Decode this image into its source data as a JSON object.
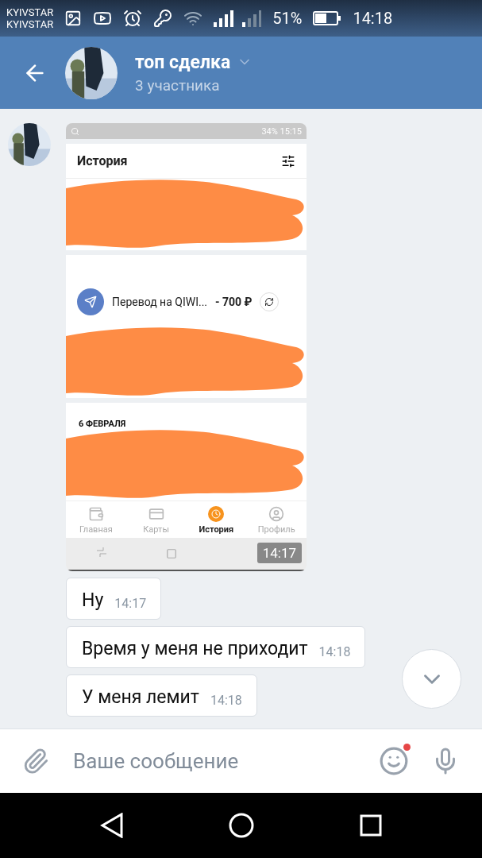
{
  "status_bar": {
    "carriers": [
      "KYIVSTAR",
      "KYIVSTAR"
    ],
    "battery": "51%",
    "time": "14:18"
  },
  "header": {
    "title": "топ сделка",
    "subtitle": "3 участника"
  },
  "messages": [
    {
      "kind": "image",
      "time": "14:17",
      "screenshot": {
        "battery": "34%",
        "time": "15:15",
        "title": "История",
        "transfer": {
          "label": "Перевод на QIWI...",
          "amount": "- 700 ₽"
        },
        "date": "6 ФЕВРАЛЯ",
        "tabs": [
          {
            "label": "Главная",
            "selected": false
          },
          {
            "label": "Карты",
            "selected": false
          },
          {
            "label": "История",
            "selected": true
          },
          {
            "label": "Профиль",
            "selected": false
          }
        ]
      }
    },
    {
      "kind": "text",
      "text": "Ну",
      "time": "14:17"
    },
    {
      "kind": "text",
      "text": "Время у меня не приходит",
      "time": "14:18"
    },
    {
      "kind": "text",
      "text": "У меня лемит",
      "time": "14:18"
    }
  ],
  "composer": {
    "placeholder": "Ваше сообщение"
  }
}
